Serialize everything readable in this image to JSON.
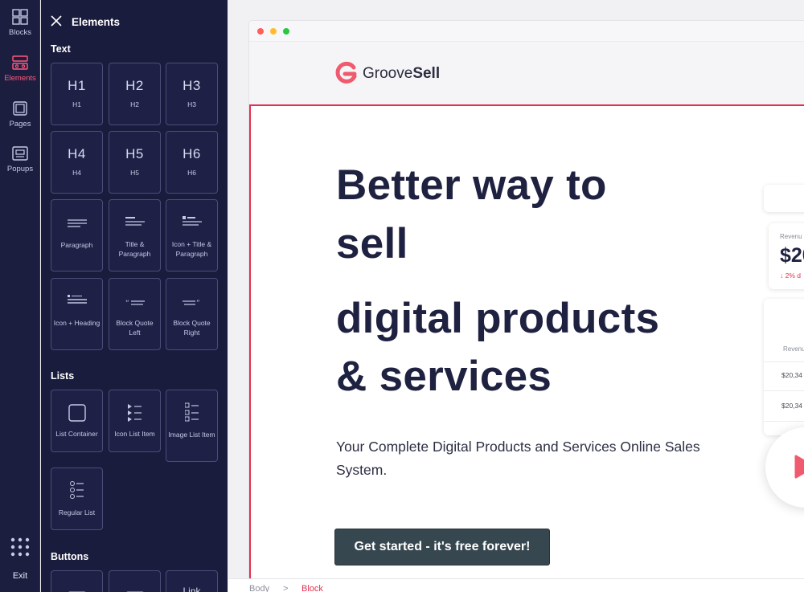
{
  "rail": {
    "items": [
      {
        "label": "Blocks",
        "icon": "blocks-icon"
      },
      {
        "label": "Elements",
        "icon": "elements-icon"
      },
      {
        "label": "Pages",
        "icon": "pages-icon"
      },
      {
        "label": "Popups",
        "icon": "popups-icon"
      }
    ],
    "active": "Elements",
    "exit_label": "Exit"
  },
  "panel": {
    "title": "Elements",
    "sections": {
      "text": "Text",
      "lists": "Lists",
      "buttons": "Buttons"
    },
    "headings": [
      {
        "big": "H1",
        "small": "H1"
      },
      {
        "big": "H2",
        "small": "H2"
      },
      {
        "big": "H3",
        "small": "H3"
      },
      {
        "big": "H4",
        "small": "H4"
      },
      {
        "big": "H5",
        "small": "H5"
      },
      {
        "big": "H6",
        "small": "H6"
      }
    ],
    "text_blocks": [
      {
        "label": "Paragraph"
      },
      {
        "label": "Title & Paragraph"
      },
      {
        "label": "Icon + Title & Paragraph"
      },
      {
        "label": "Icon + Heading"
      },
      {
        "label": "Block Quote Left"
      },
      {
        "label": "Block Quote Right"
      }
    ],
    "lists": [
      {
        "label": "List Container"
      },
      {
        "label": "Icon List Item"
      },
      {
        "label": "Image List Item"
      },
      {
        "label": "Regular List"
      }
    ],
    "buttons_partial": [
      {
        "label": ""
      },
      {
        "label": ""
      },
      {
        "label": "Link"
      }
    ]
  },
  "site": {
    "logo_text_light": "Groove",
    "logo_text_bold": "Sell",
    "hero_line1": "Better way to",
    "hero_line2": "sell",
    "hero_line3": "digital products",
    "hero_line4": "& services",
    "subtitle": "Your Complete Digital Products and Services Online Sales System.",
    "cta_label": "Get started - it's free forever!",
    "mock": {
      "revenue_label": "Revenu",
      "revenue_value": "$20",
      "delta": "2% d",
      "table_header": "Revenu",
      "rows": [
        "$20,34",
        "$20,34"
      ]
    }
  },
  "breadcrumb": {
    "items": [
      "Body",
      "Block"
    ],
    "separator": ">"
  },
  "colors": {
    "accent": "#ff5a79",
    "selection": "#e3314f",
    "panel_bg": "#1a1c3d",
    "cta_bg": "#37474f",
    "text_dark": "#1f2140"
  }
}
